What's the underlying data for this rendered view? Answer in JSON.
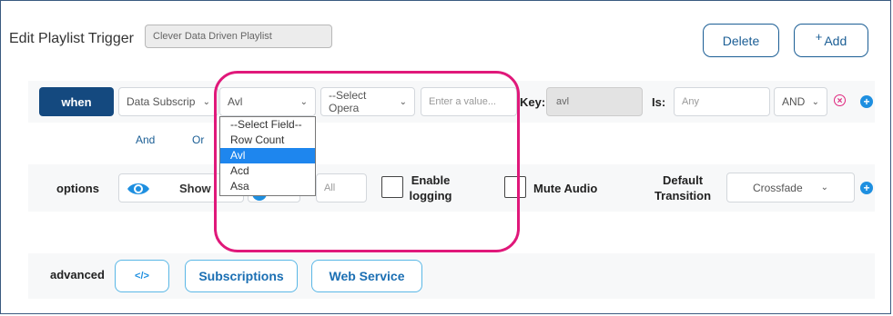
{
  "header": {
    "title": "Edit Playlist Trigger",
    "playlist_name": "Clever Data Driven Playlist",
    "delete_label": "Delete",
    "add_label": "Add",
    "add_symbol": "+"
  },
  "when_row": {
    "when_label": "when",
    "source_select": "Data Subscrip",
    "field_select": "Avl",
    "operator_select": "--Select Opera",
    "value_placeholder": "Enter a value...",
    "key_label": "Key:",
    "key_value": "avl",
    "is_label": "Is:",
    "is_placeholder": "Any",
    "logic_select": "AND",
    "and_label": "And",
    "or_label": "Or",
    "remove_icon": "x-circle-icon",
    "add_icon": "plus-circle-icon"
  },
  "field_dropdown": {
    "options": [
      "--Select Field--",
      "Row Count",
      "Avl",
      "Acd",
      "Asa"
    ],
    "selected": "Avl"
  },
  "options_row": {
    "options_label": "options",
    "show_label": "Show",
    "all_placeholder": "All",
    "enable_logging_label": "Enable logging",
    "mute_audio_label": "Mute Audio",
    "default_transition_label": "Default Transition",
    "transition_select": "Crossfade"
  },
  "advanced_row": {
    "advanced_label": "advanced",
    "code_icon_label": "</>",
    "subscriptions_label": "Subscriptions",
    "web_service_label": "Web Service"
  },
  "colors": {
    "primary": "#14497f",
    "accent": "#1e8fe0",
    "highlight": "#e0187a",
    "remove": "#e0257d"
  }
}
